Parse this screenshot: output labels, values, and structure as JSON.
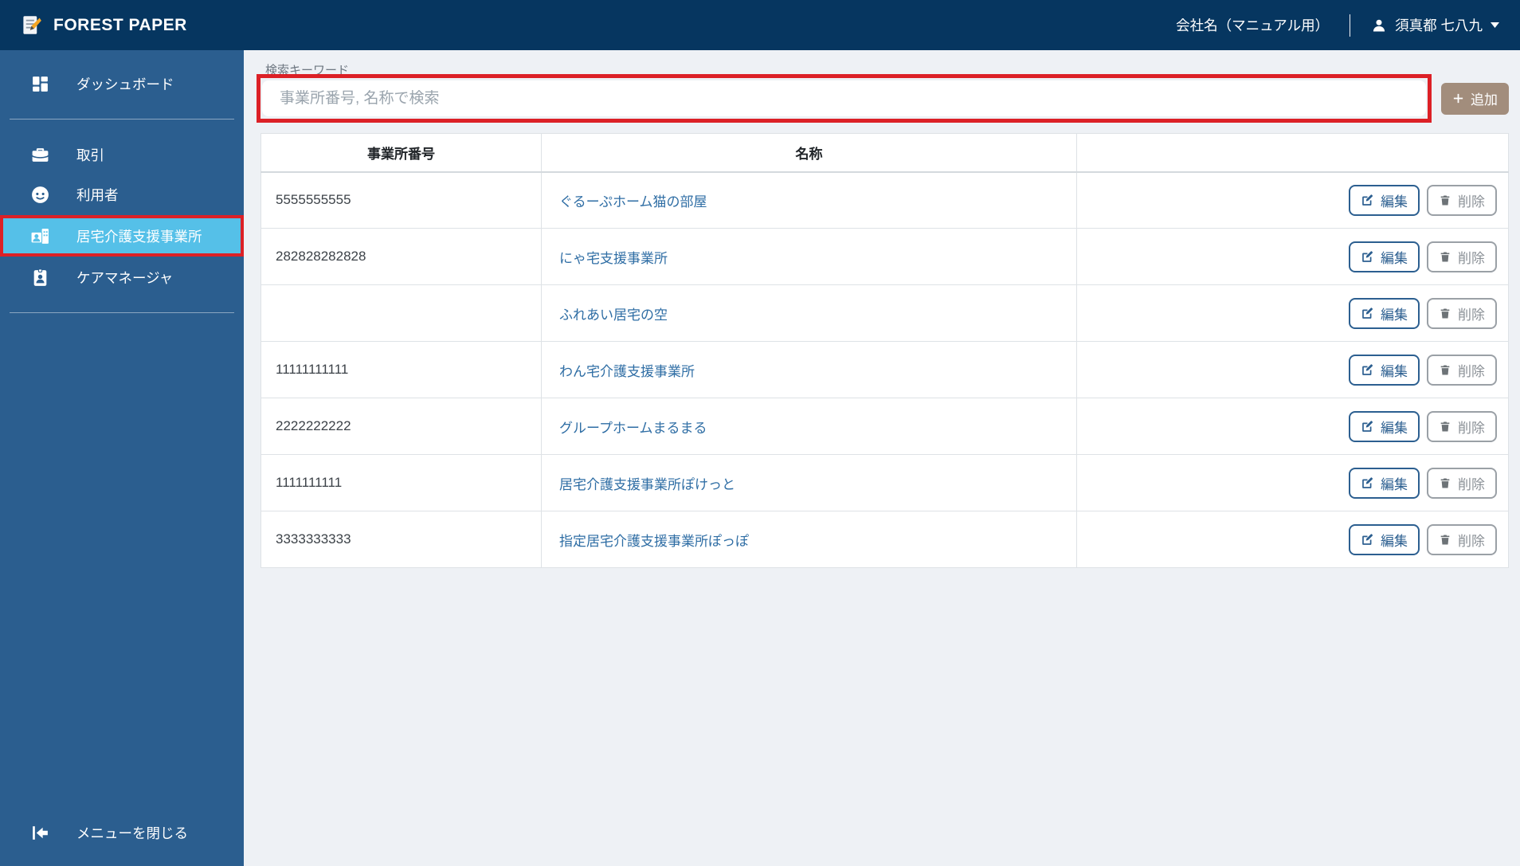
{
  "header": {
    "app_title": "FOREST PAPER",
    "company_name": "会社名（マニュアル用）",
    "user_name": "須真都 七八九"
  },
  "sidebar": {
    "items": [
      {
        "label": "ダッシュボード",
        "icon": "dashboard-icon",
        "active": false
      },
      {
        "label": "取引",
        "icon": "briefcase-icon",
        "active": false
      },
      {
        "label": "利用者",
        "icon": "user-smile-icon",
        "active": false
      },
      {
        "label": "居宅介護支援事業所",
        "icon": "office-card-icon",
        "active": true,
        "annotated": true
      },
      {
        "label": "ケアマネージャ",
        "icon": "id-badge-icon",
        "active": false
      }
    ],
    "collapse_label": "メニューを閉じる"
  },
  "search": {
    "label": "検索キーワード",
    "placeholder": "事業所番号, 名称で検索",
    "value": "",
    "annotated": true
  },
  "toolbar": {
    "add_label": "追加"
  },
  "table": {
    "columns": [
      "事業所番号",
      "名称",
      ""
    ],
    "edit_label": "編集",
    "delete_label": "削除",
    "rows": [
      {
        "office_number": "5555555555",
        "name": "ぐるーぷホーム猫の部屋"
      },
      {
        "office_number": "282828282828",
        "name": "にゃ宅支援事業所"
      },
      {
        "office_number": "",
        "name": "ふれあい居宅の空"
      },
      {
        "office_number": "11111111111",
        "name": "わん宅介護支援事業所"
      },
      {
        "office_number": "2222222222",
        "name": "グループホームまるまる"
      },
      {
        "office_number": "1111111111",
        "name": "居宅介護支援事業所ぽけっと"
      },
      {
        "office_number": "3333333333",
        "name": "指定居宅介護支援事業所ぽっぽ"
      }
    ]
  },
  "colors": {
    "header_bg": "#063660",
    "sidebar_bg": "#2b5e8f",
    "active_item_bg": "#55c0e8",
    "annotation_red": "#dc2026",
    "content_bg": "#eef1f5",
    "link_blue": "#2e6da4",
    "add_button_bg": "#a28d7c",
    "edit_blue": "#2c5f90",
    "delete_gray": "#8a9096"
  }
}
